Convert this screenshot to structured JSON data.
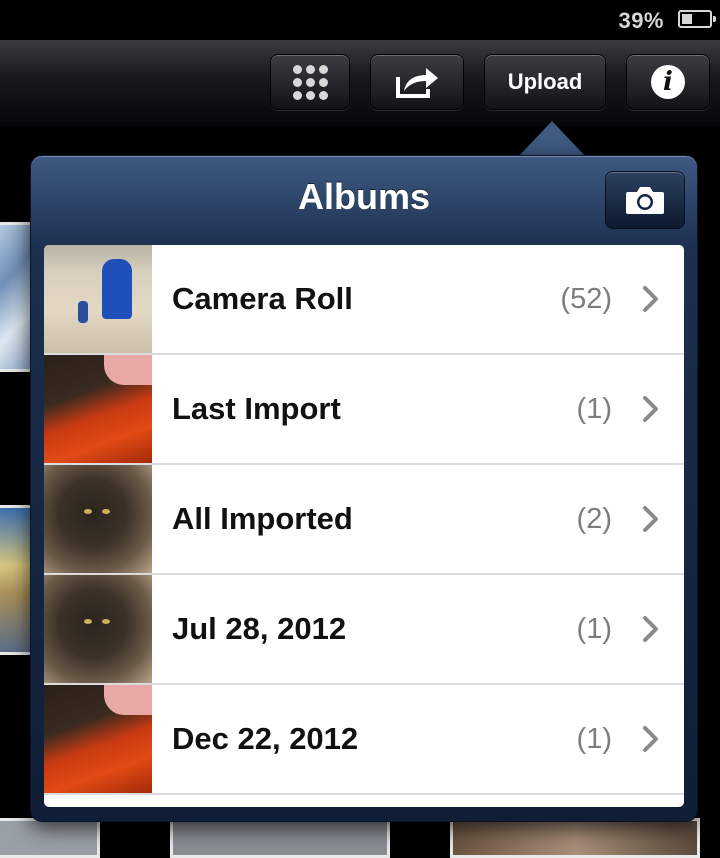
{
  "status_bar": {
    "battery_text": "39%",
    "battery_level": 0.39
  },
  "toolbar": {
    "grid_icon": "grid-icon",
    "share_icon": "share-arrow-icon",
    "upload_label": "Upload",
    "info_glyph": "i"
  },
  "albums_popover": {
    "title": "Albums",
    "camera_icon": "camera-icon",
    "items": [
      {
        "label": "Camera Roll",
        "count": "(52)",
        "thumbnail": "desert-photo"
      },
      {
        "label": "Last Import",
        "count": "(1)",
        "thumbnail": "cat-red-blanket-photo"
      },
      {
        "label": "All Imported",
        "count": "(2)",
        "thumbnail": "cat-photo"
      },
      {
        "label": "Jul 28, 2012",
        "count": "(1)",
        "thumbnail": "cat-photo"
      },
      {
        "label": "Dec 22, 2012",
        "count": "(1)",
        "thumbnail": "cat-red-blanket-photo"
      }
    ]
  },
  "colors": {
    "popover_header": "#1c2f4f",
    "accent_chevron": "#8a8a8a"
  }
}
